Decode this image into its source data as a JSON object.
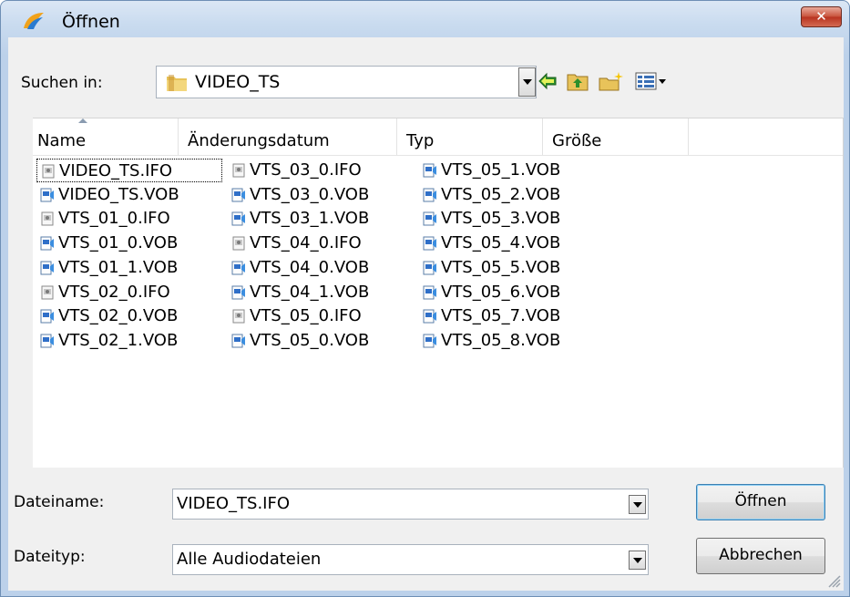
{
  "window": {
    "title": "Öffnen",
    "close_symbol": "✕"
  },
  "lookin": {
    "label": "Suchen in:",
    "value": "VIDEO_TS"
  },
  "toolbar": {
    "icons": [
      "back-arrow-icon",
      "up-folder-icon",
      "new-folder-icon",
      "view-menu-icon"
    ]
  },
  "columns": [
    "Name",
    "Änderungsdatum",
    "Typ",
    "Größe"
  ],
  "files": [
    [
      "VIDEO_TS.IFO",
      "VIDEO_TS.VOB",
      "VTS_01_0.IFO",
      "VTS_01_0.VOB",
      "VTS_01_1.VOB",
      "VTS_02_0.IFO",
      "VTS_02_0.VOB",
      "VTS_02_1.VOB"
    ],
    [
      "VTS_03_0.IFO",
      "VTS_03_0.VOB",
      "VTS_03_1.VOB",
      "VTS_04_0.IFO",
      "VTS_04_0.VOB",
      "VTS_04_1.VOB",
      "VTS_05_0.IFO",
      "VTS_05_0.VOB"
    ],
    [
      "VTS_05_1.VOB",
      "VTS_05_2.VOB",
      "VTS_05_3.VOB",
      "VTS_05_4.VOB",
      "VTS_05_5.VOB",
      "VTS_05_6.VOB",
      "VTS_05_7.VOB",
      "VTS_05_8.VOB"
    ]
  ],
  "filename": {
    "label": "Dateiname:",
    "value": "VIDEO_TS.IFO"
  },
  "filetype": {
    "label": "Dateityp:",
    "value": "Alle Audiodateien"
  },
  "buttons": {
    "open": "Öffnen",
    "cancel": "Abbrechen"
  },
  "colors": {
    "selection_outline": "#000000",
    "title_gradient_top": "#dbe7f5",
    "close_red": "#c8513a"
  }
}
